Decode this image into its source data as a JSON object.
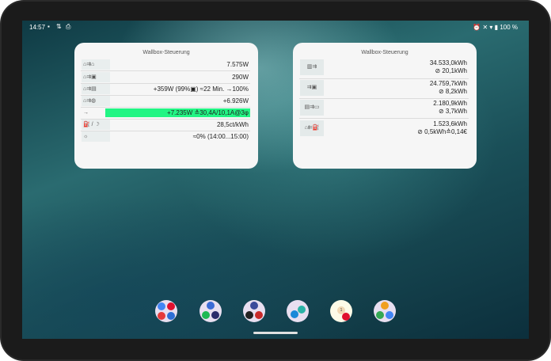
{
  "status_bar": {
    "time": "14:57",
    "battery": "100 %",
    "left_icons": [
      "contact-card-icon",
      "data-transfer-icon",
      "printer-icon"
    ],
    "right_icons": [
      "alarm-icon",
      "mute-icon",
      "wifi-icon",
      "battery-icon"
    ]
  },
  "widget_left": {
    "title": "Wallbox-Steuerung",
    "rows": [
      {
        "icon": "⌂⇉⌂",
        "value": "7.575W"
      },
      {
        "icon": "⌂⇉▣",
        "value": "290W"
      },
      {
        "icon": "⌂⇉▤",
        "value": "+359W (99%▣)  ≈22 Min. →100%"
      },
      {
        "icon": "⌂⇉◍",
        "value": "+6.926W"
      },
      {
        "icon": "→",
        "value": "+7.235W ≙30,4A/10,1A@3φ",
        "highlight": true
      },
      {
        "icon": "⛽ / ☽",
        "value": "28,5ct/kWh"
      },
      {
        "icon": "☼",
        "value": "≈0% (14:00...15:00)"
      }
    ]
  },
  "widget_right": {
    "title": "Wallbox-Steuerung",
    "rows": [
      {
        "icon": "▥⇉",
        "line1": "34.533,0kWh",
        "line2": "⊘ 20,1kWh"
      },
      {
        "icon": "⇉▣",
        "line1": "24.759,7kWh",
        "line2": "⊘ 8,2kWh"
      },
      {
        "icon": "▤⇉▭",
        "line1": "2.180,9kWh",
        "line2": "⊘ 3,7kWh"
      },
      {
        "icon": "⌂⇇⛽",
        "line1": "1.523,6kWh",
        "line2": "⊘ 0,5kWh≙0,14€"
      }
    ]
  },
  "dock": {
    "folder_badge": "1"
  },
  "colors": {
    "highlight_bar": "#22f584",
    "widget_bg": "#f6f6f6"
  }
}
